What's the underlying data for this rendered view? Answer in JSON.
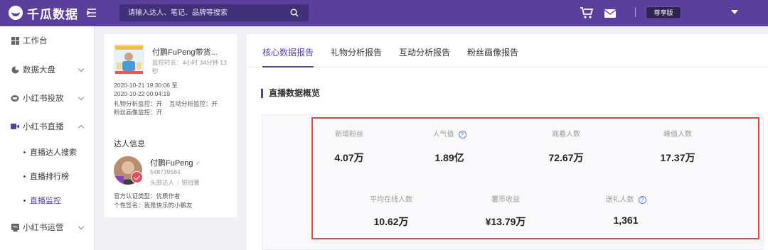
{
  "header": {
    "brand": "千瓜数据",
    "search_placeholder": "请输入达人、笔记、品牌等搜索",
    "plan": "尊享版"
  },
  "sidebar": {
    "items": [
      {
        "label": "工作台",
        "icon": "dashboard-icon"
      },
      {
        "label": "数据大盘",
        "icon": "pie-chart-icon"
      },
      {
        "label": "小红书投放",
        "icon": "placement-icon"
      },
      {
        "label": "小红书直播",
        "icon": "video-icon"
      },
      {
        "label": "小红书运营",
        "icon": "operations-icon"
      }
    ],
    "sub_items": [
      {
        "label": "直播达人搜索"
      },
      {
        "label": "直播排行榜"
      },
      {
        "label": "直播监控"
      }
    ]
  },
  "streamer": {
    "title": "付鹏FuPeng带货...",
    "monitor_duration": "监控时长：4小时 34分钟 13秒",
    "time_range_start": "2020-10-21 19:30:06 至",
    "time_range_end": "2020-10-22 00:04:19",
    "gift_monitor": "礼物分析监控：开",
    "interaction_monitor": "互动分析监控：开",
    "fan_monitor": "粉丝画像监控：开",
    "talent_heading": "达人信息",
    "name": "付鹏FuPeng",
    "gender_icon": "male-icon",
    "id": "548739584",
    "tag_level": "头部达人",
    "tag_rank": "铜冠薯",
    "cert_type": "官方认证类型：优质作者",
    "signature": "个性签名：我是快乐的小鹏友"
  },
  "main": {
    "tabs": [
      "核心数据报告",
      "礼物分析报告",
      "互动分析报告",
      "粉丝画像报告"
    ],
    "section_title": "直播数据概览",
    "accent": "#5b3f9c",
    "highlight_color": "#e14848"
  },
  "stats": {
    "row1": [
      {
        "label": "新增粉丝",
        "value": "4.07万",
        "help": false
      },
      {
        "label": "人气值",
        "value": "1.89亿",
        "help": true
      },
      {
        "label": "观看人数",
        "value": "72.67万",
        "help": false
      },
      {
        "label": "峰值人数",
        "value": "17.37万",
        "help": false
      }
    ],
    "row2": [
      {
        "label": "平均在线人数",
        "value": "10.62万",
        "help": false
      },
      {
        "label": "薯币收益",
        "value": "¥13.79万",
        "help": false
      },
      {
        "label": "送礼人数",
        "value": "1,361",
        "help": true
      }
    ]
  }
}
